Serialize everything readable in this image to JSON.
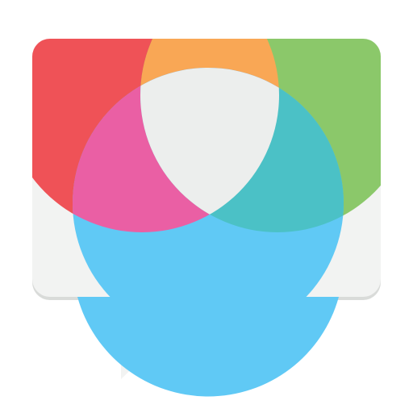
{
  "logo": {
    "name": "chat-bubble-venn-logo",
    "colors": {
      "bubble_base": "#f2f3f2",
      "bubble_shadow": "#d9dbd9",
      "red": "#ef5257",
      "orange": "#f9a755",
      "green": "#8bc86a",
      "magenta": "#ea5fa4",
      "teal": "#4bc1c6",
      "blue": "#60c9f5",
      "center": "#eceeed"
    }
  }
}
